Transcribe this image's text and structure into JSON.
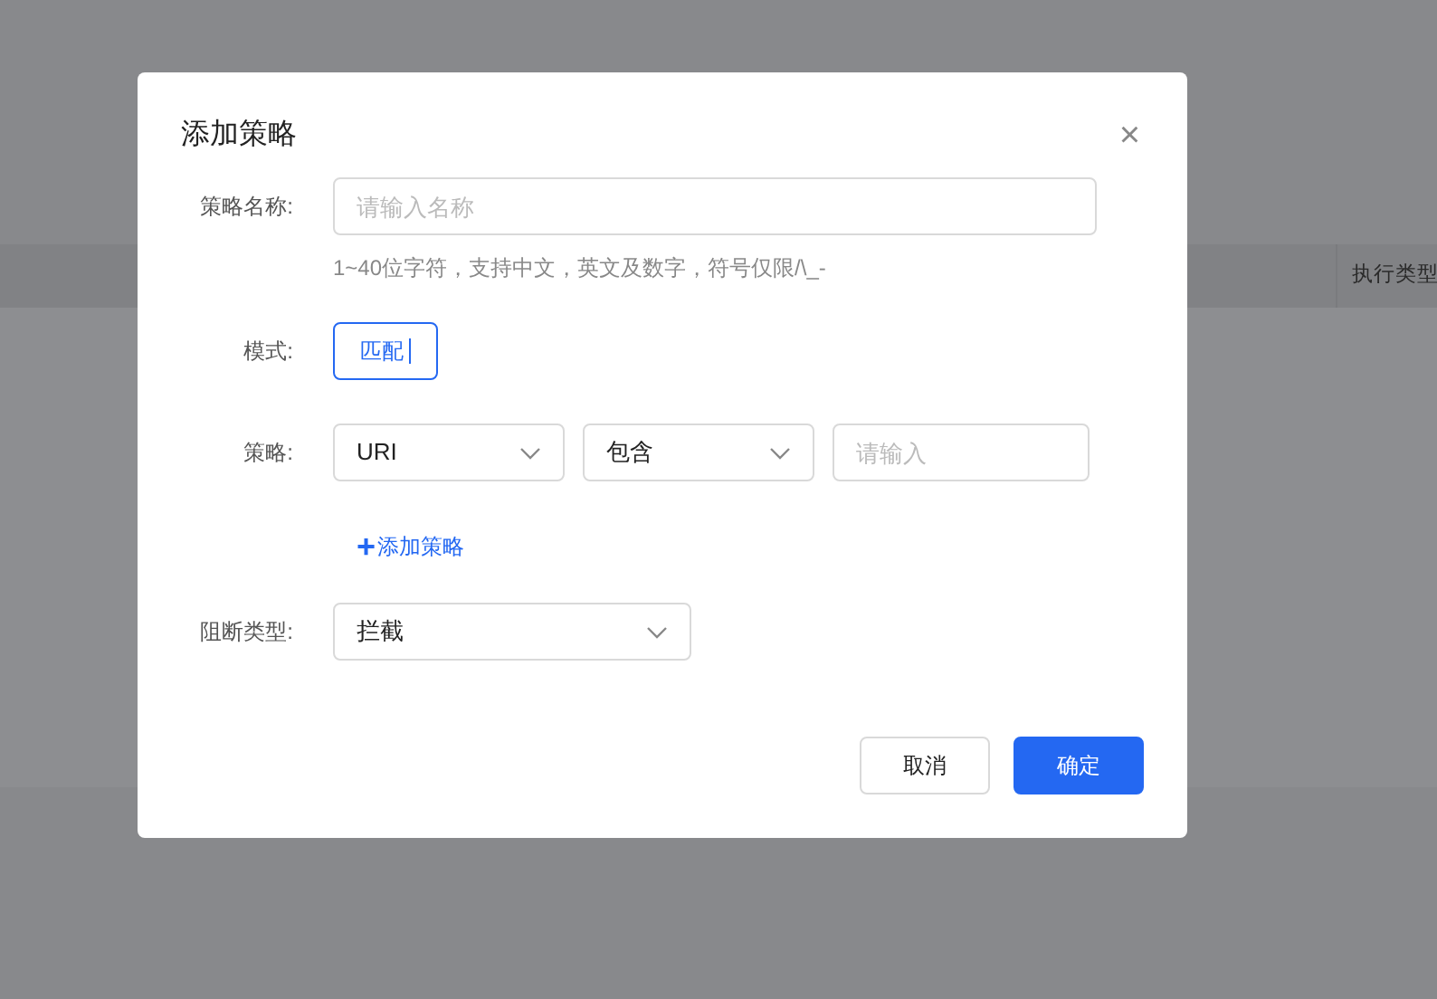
{
  "background_table": {
    "columns": [
      "执行类型"
    ]
  },
  "dialog": {
    "title": "添加策略",
    "close": "×",
    "name_field": {
      "label": "策略名称:",
      "placeholder": "请输入名称",
      "hint": "1~40位字符，支持中文，英文及数字，符号仅限/\\_-"
    },
    "mode": {
      "label": "模式:",
      "options": [
        {
          "label": "匹配",
          "selected": true
        }
      ]
    },
    "policy": {
      "label": "策略:",
      "field": "URI",
      "operator": "包含",
      "value_placeholder": "请输入"
    },
    "add_policy": {
      "icon": "+",
      "label": "添加策略"
    },
    "block_type": {
      "label": "阻断类型:",
      "value": "拦截"
    },
    "buttons": [
      {
        "label": "取消",
        "kind": "secondary"
      },
      {
        "label": "确定",
        "kind": "primary"
      }
    ]
  }
}
